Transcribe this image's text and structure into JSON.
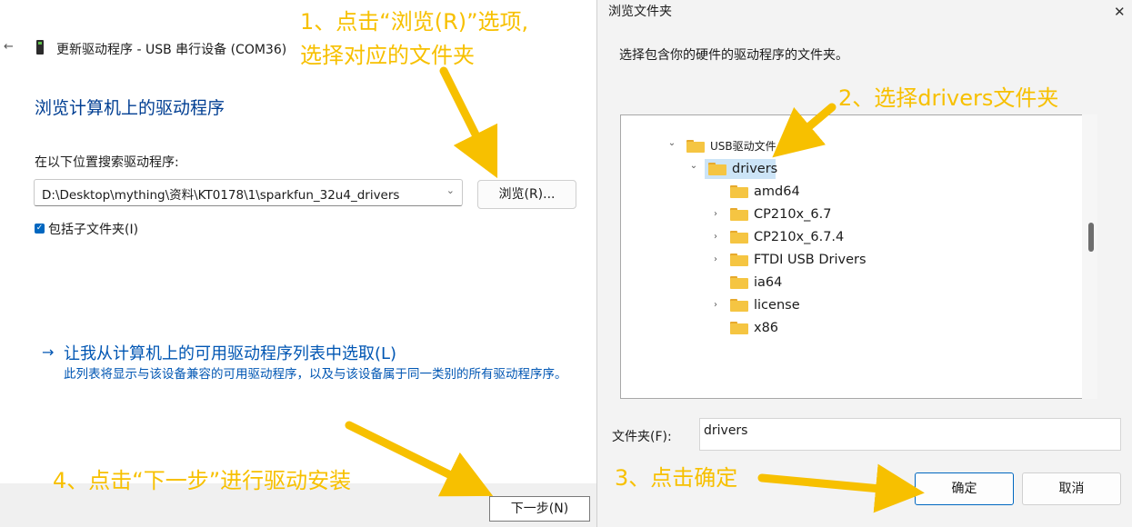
{
  "wizard": {
    "back_icon": "←",
    "title": "更新驱动程序 - USB 串行设备 (COM36)",
    "heading": "浏览计算机上的驱动程序",
    "search_label": "在以下位置搜索驱动程序:",
    "path_value": "D:\\Desktop\\mything\\资料\\KT0178\\1\\sparkfun_32u4_drivers",
    "browse_label": "浏览(R)...",
    "include_subfolders_label": "包括子文件夹(I)",
    "include_subfolders_checked": true,
    "pick_link": "让我从计算机上的可用驱动程序列表中选取(L)",
    "pick_desc": "此列表将显示与该设备兼容的可用驱动程序，以及与该设备属于同一类别的所有驱动程序序。",
    "next_label": "下一步(N)"
  },
  "dialog": {
    "title": "浏览文件夹",
    "close_icon": "✕",
    "instruction": "选择包含你的硬件的驱动程序的文件夹。",
    "tree": [
      {
        "label": "USB驱动文件",
        "expanded": true,
        "level": 0
      },
      {
        "label": "drivers",
        "expanded": true,
        "level": 1,
        "selected": true
      },
      {
        "label": "amd64",
        "expandable": false,
        "level": 2
      },
      {
        "label": "CP210x_6.7",
        "expandable": true,
        "level": 2
      },
      {
        "label": "CP210x_6.7.4",
        "expandable": true,
        "level": 2
      },
      {
        "label": "FTDI USB Drivers",
        "expandable": true,
        "level": 2
      },
      {
        "label": "ia64",
        "expandable": false,
        "level": 2
      },
      {
        "label": "license",
        "expandable": true,
        "level": 2
      },
      {
        "label": "x86",
        "expandable": false,
        "level": 2
      }
    ],
    "folder_label": "文件夹(F):",
    "folder_value": "drivers",
    "ok_label": "确定",
    "cancel_label": "取消"
  },
  "annotations": {
    "step1_line1": "1、点击“浏览(R)”选项,",
    "step1_line2": "选择对应的文件夹",
    "step2": "2、选择drivers文件夹",
    "step3": "3、点击确定",
    "step4": "4、点击“下一步”进行驱动安装",
    "color": "#f7c000"
  },
  "colors": {
    "accent": "#0067c0",
    "link": "#0056b3",
    "heading": "#003e92",
    "folder": "#f5c542",
    "selection": "#cce4f7"
  }
}
